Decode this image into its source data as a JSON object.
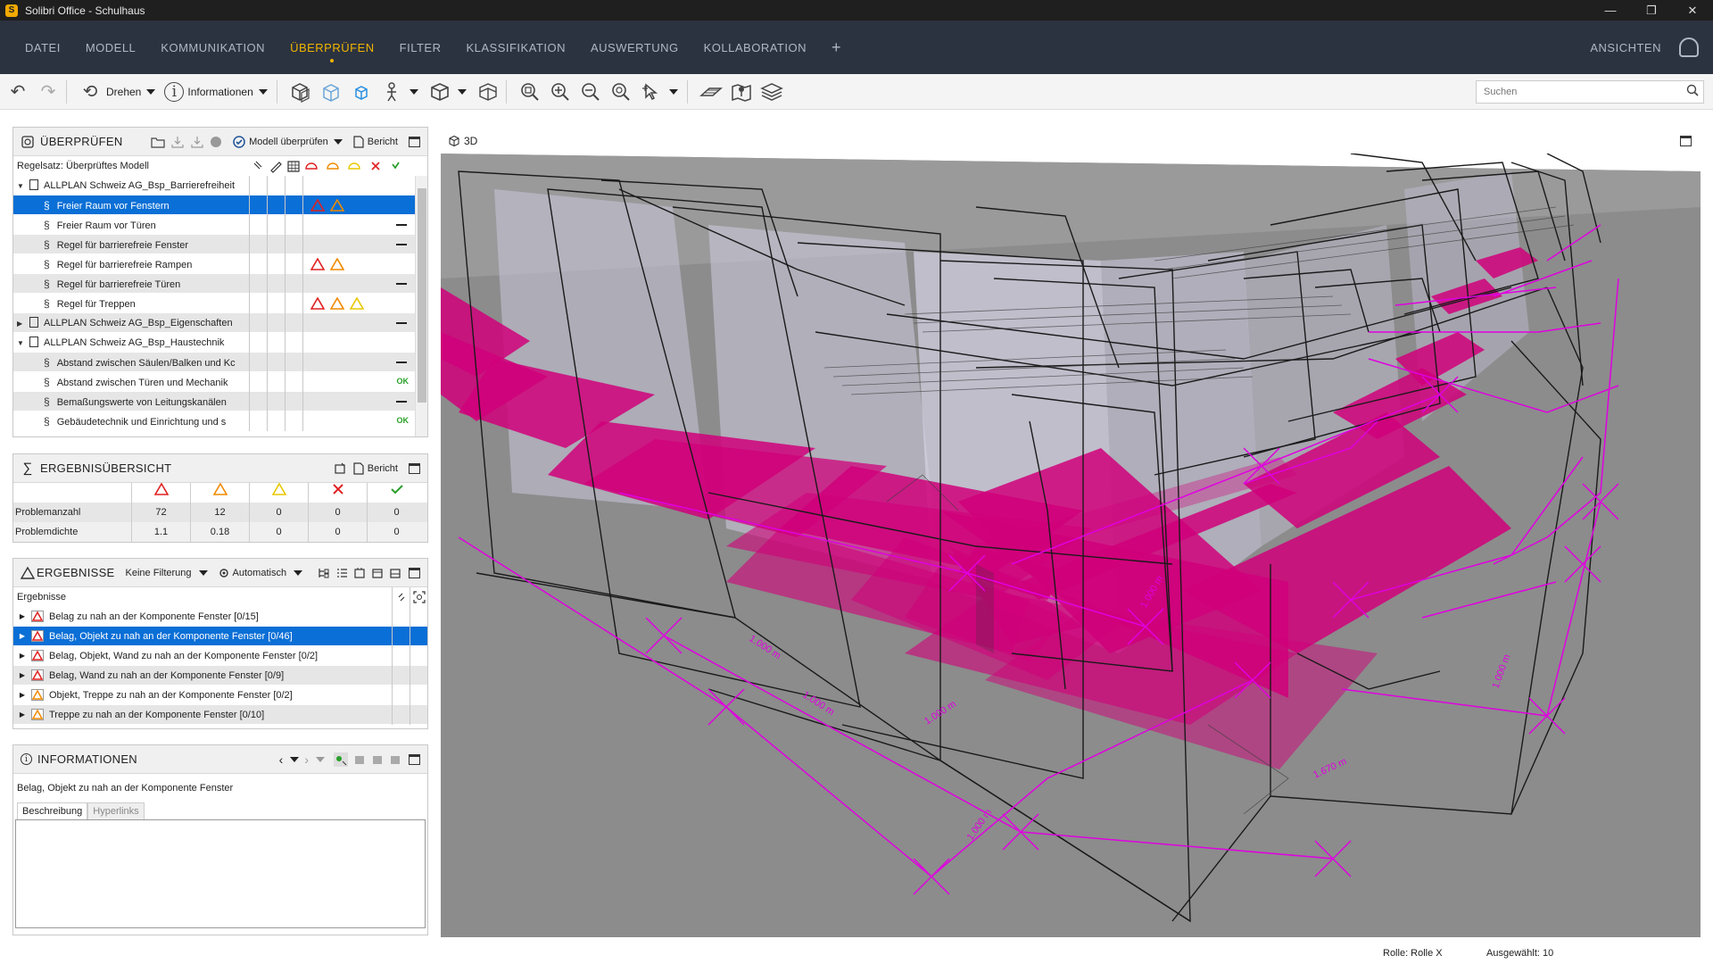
{
  "window": {
    "title": "Solibri Office - Schulhaus",
    "app_icon": "S"
  },
  "menu": {
    "items": [
      "DATEI",
      "MODELL",
      "KOMMUNIKATION",
      "ÜBERPRÜFEN",
      "FILTER",
      "KLASSIFIKATION",
      "AUSWERTUNG",
      "KOLLABORATION"
    ],
    "active": "ÜBERPRÜFEN",
    "plus": "+",
    "right_label": "ANSICHTEN"
  },
  "toolbar": {
    "rotate_label": "Drehen",
    "info_label": "Informationen",
    "search_placeholder": "Suchen"
  },
  "check_panel": {
    "title": "ÜBERPRÜFEN",
    "check_model_label": "Modell überprüfen",
    "report_label": "Bericht",
    "ruleset_label": "Regelsatz: Überprüftes Modell",
    "rows": [
      {
        "level": 0,
        "expand": "▼",
        "name": "ALLPLAN Schweiz AG_Bsp_Barrierefreiheit",
        "status": "",
        "selected": false
      },
      {
        "level": 1,
        "name": "Freier Raum vor Fenstern",
        "status": "red-orange",
        "selected": true
      },
      {
        "level": 1,
        "name": "Freier Raum vor Türen",
        "status": "dash",
        "selected": false
      },
      {
        "level": 1,
        "name": "Regel für barrierefreie Fenster",
        "status": "dash",
        "selected": false
      },
      {
        "level": 1,
        "name": "Regel für barrierefreie Rampen",
        "status": "red-orange",
        "selected": false
      },
      {
        "level": 1,
        "name": "Regel für barrierefreie Türen",
        "status": "dash",
        "selected": false
      },
      {
        "level": 1,
        "name": "Regel für Treppen",
        "status": "red-orange-yellow",
        "selected": false
      },
      {
        "level": 0,
        "expand": "▶",
        "name": "ALLPLAN Schweiz AG_Bsp_Eigenschaften",
        "status": "dash",
        "selected": false
      },
      {
        "level": 0,
        "expand": "▼",
        "name": "ALLPLAN Schweiz AG_Bsp_Haustechnik",
        "status": "",
        "selected": false
      },
      {
        "level": 1,
        "name": "Abstand zwischen Säulen/Balken und Kc",
        "status": "dash",
        "selected": false
      },
      {
        "level": 1,
        "name": "Abstand zwischen Türen  und Mechanik",
        "status": "ok",
        "selected": false
      },
      {
        "level": 1,
        "name": "Bemaßungswerte von Leitungskanälen",
        "status": "dash",
        "selected": false
      },
      {
        "level": 1,
        "name": "Gebäudetechnik und Einrichtung und s",
        "status": "ok",
        "selected": false
      }
    ],
    "ok_text": "OK"
  },
  "summary_panel": {
    "title": "ERGEBNISÜBERSICHT",
    "report_label": "Bericht",
    "rows": [
      {
        "label": "Problemanzahl",
        "values": [
          "72",
          "12",
          "0",
          "0",
          "0"
        ]
      },
      {
        "label": "Problemdichte",
        "values": [
          "1.1",
          "0.18",
          "0",
          "0",
          "0"
        ]
      }
    ]
  },
  "results_panel": {
    "title": "ERGEBNISSE",
    "filter_label": "Keine Filterung",
    "auto_label": "Automatisch",
    "header": "Ergebnisse",
    "rows": [
      {
        "text": "Belag zu nah an der Komponente Fenster [0/15]",
        "severity": "red",
        "selected": false
      },
      {
        "text": "Belag, Objekt zu nah an der Komponente Fenster [0/46]",
        "severity": "red",
        "selected": true
      },
      {
        "text": "Belag, Objekt, Wand zu nah an der Komponente Fenster [0/2]",
        "severity": "red",
        "selected": false
      },
      {
        "text": "Belag, Wand zu nah an der Komponente Fenster [0/9]",
        "severity": "red",
        "selected": false
      },
      {
        "text": "Objekt, Treppe zu nah an der Komponente Fenster [0/2]",
        "severity": "orange",
        "selected": false
      },
      {
        "text": "Treppe zu nah an der Komponente Fenster [0/10]",
        "severity": "orange",
        "selected": false
      }
    ]
  },
  "info_panel": {
    "title": "INFORMATIONEN",
    "subject": "Belag, Objekt zu nah an der Komponente Fenster",
    "tabs": [
      "Beschreibung",
      "Hyperlinks"
    ]
  },
  "view": {
    "label": "3D",
    "dimension_labels": [
      "1.000 m",
      "1.000 m",
      "1.000 m",
      "1.000 m",
      "1.000 m",
      "1.670 m",
      "1.000 m"
    ]
  },
  "status": {
    "role": "Rolle: Rolle X",
    "selected": "Ausgewählt: 10"
  },
  "colors": {
    "accent": "#f0b400",
    "menubar": "#2c3340",
    "selection": "#0a6fd6",
    "magenta": "#d0007a",
    "dimension": "#e000e0"
  }
}
